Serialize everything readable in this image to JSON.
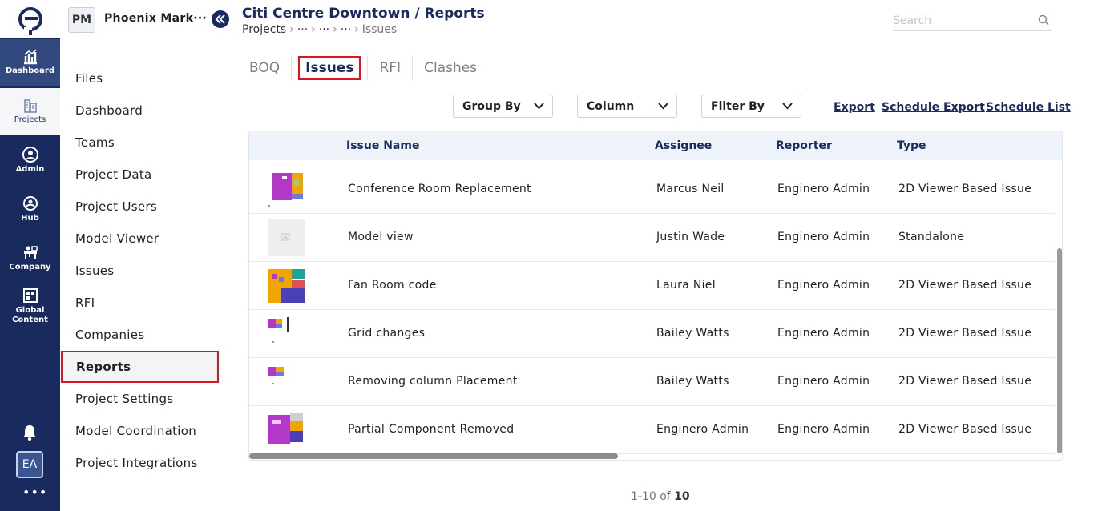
{
  "rail": {
    "items": [
      {
        "label": "Dashboard",
        "icon": "chart-icon"
      },
      {
        "label": "Projects",
        "icon": "building-icon"
      },
      {
        "label": "Admin",
        "icon": "user-circle-icon"
      },
      {
        "label": "Hub",
        "icon": "hub-icon"
      },
      {
        "label": "Company",
        "icon": "company-icon"
      },
      {
        "label": "Global Content",
        "icon": "global-content-icon"
      }
    ],
    "avatar": "EA",
    "more": "•••"
  },
  "project": {
    "badge": "PM",
    "name": "Phoenix Mark···"
  },
  "sidebar": {
    "items": [
      "Files",
      "Dashboard",
      "Teams",
      "Project Data",
      "Project Users",
      "Model Viewer",
      "Issues",
      "RFI",
      "Companies",
      "Reports",
      "Project Settings",
      "Model Coordination",
      "Project Integrations"
    ],
    "active": "Reports"
  },
  "header": {
    "title": "Citi Centre Downtown / Reports",
    "crumbs": [
      "Projects",
      "···",
      "···",
      "···",
      "Issues"
    ]
  },
  "search": {
    "placeholder": "Search"
  },
  "tabs": [
    "BOQ",
    "Issues",
    "RFI",
    "Clashes"
  ],
  "active_tab": "Issues",
  "toolbar": {
    "group_by": "Group By",
    "column": "Column",
    "filter_by": "Filter By",
    "export": "Export",
    "schedule_export": "Schedule Export",
    "schedule_list": "Schedule List"
  },
  "table": {
    "headers": [
      "Issue Name",
      "Assignee",
      "Reporter",
      "Type"
    ],
    "rows": [
      {
        "name": "Conference Room Replacement",
        "assignee": "Marcus Neil",
        "reporter": "Enginero Admin",
        "type": "2D Viewer Based Issue",
        "thumb": "purple"
      },
      {
        "name": "Model view",
        "assignee": "Justin Wade",
        "reporter": "Enginero Admin",
        "type": "Standalone",
        "thumb": "blank"
      },
      {
        "name": "Fan Room code",
        "assignee": "Laura Niel",
        "reporter": "Enginero Admin",
        "type": "2D Viewer Based Issue",
        "thumb": "orange"
      },
      {
        "name": "Grid changes",
        "assignee": "Bailey Watts",
        "reporter": "Enginero Admin",
        "type": "2D Viewer Based Issue",
        "thumb": "small"
      },
      {
        "name": "Removing column Placement",
        "assignee": "Bailey Watts",
        "reporter": "Enginero Admin",
        "type": "2D Viewer Based Issue",
        "thumb": "small"
      },
      {
        "name": "Partial Component Removed",
        "assignee": "Enginero Admin",
        "reporter": "Enginero Admin",
        "type": "2D Viewer Based Issue",
        "thumb": "purple"
      }
    ]
  },
  "pager": {
    "range": "1-10 of",
    "total": "10"
  }
}
